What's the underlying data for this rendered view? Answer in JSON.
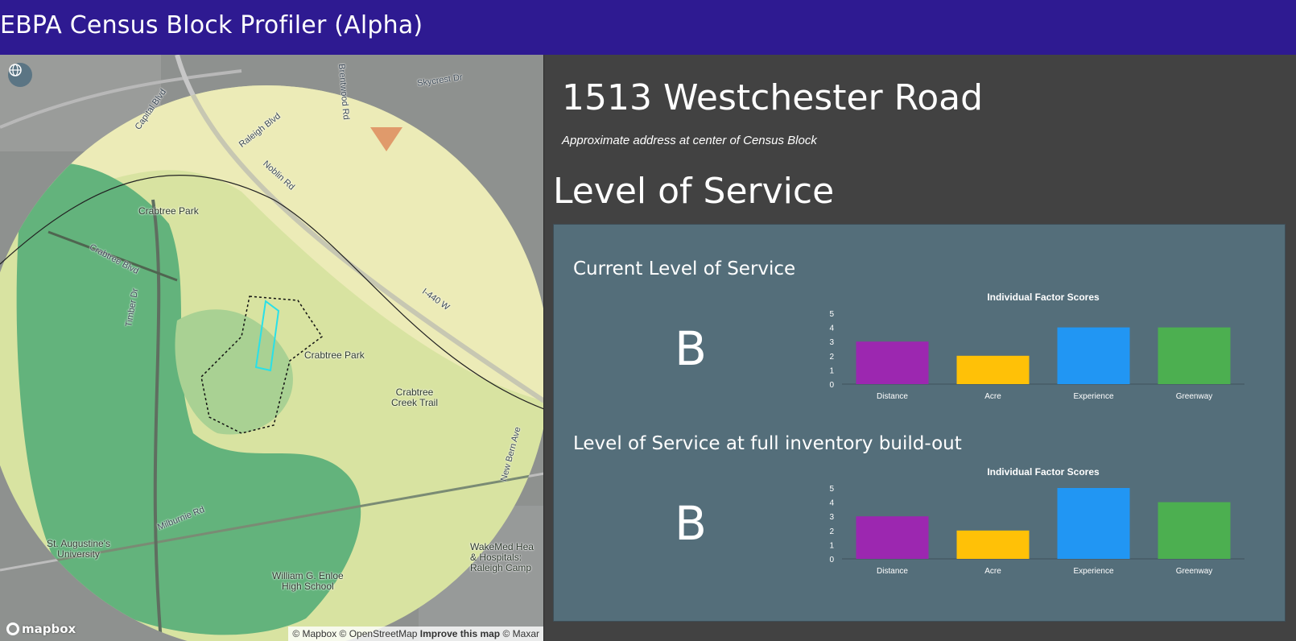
{
  "app": {
    "title": "EBPA Census Block Profiler (Alpha)"
  },
  "map": {
    "labels": {
      "crabtree_park_1": "Crabtree Park",
      "crabtree_park_2": "Crabtree Park",
      "crabtree_creek_trail": "Crabtree\nCreek Trail",
      "st_augustines": "St. Augustine's\nUniversity",
      "wakemed": "WakeMed Hea\n& Hospitals:\nRaleigh Camp",
      "enloe": "William G. Enloe\nHigh School"
    },
    "streets": {
      "skycrest": "Skycrest Dr",
      "brentwood": "Brentwood Rd",
      "capital": "Capital Blvd",
      "raleigh": "Raleigh Blvd",
      "noblin": "Noblin Rd",
      "crabtree_blvd": "Crabtree Blvd",
      "timber": "Timber Dr",
      "i440": "I-440 W",
      "new_bern": "New Bern Ave",
      "milburnie": "Milburnie Rd"
    },
    "logo_text": "mapbox",
    "attribution": {
      "mapbox": "© Mapbox",
      "osm": "© OpenStreetMap",
      "improve": "Improve this map",
      "maxar": "© Maxar"
    },
    "icons": {
      "globe": "globe-icon"
    }
  },
  "panel": {
    "address": "1513 Westchester Road",
    "address_note": "Approximate address at center of Census Block",
    "los_heading": "Level of Service",
    "current": {
      "title": "Current Level of Service",
      "grade": "B"
    },
    "buildout": {
      "title": "Level of Service at full inventory build-out",
      "grade": "B"
    }
  },
  "chart_data": [
    {
      "type": "bar",
      "title": "Individual Factor Scores",
      "categories": [
        "Distance",
        "Acre",
        "Experience",
        "Greenway"
      ],
      "values": [
        3,
        2,
        4,
        4
      ],
      "colors": [
        "#9c27b0",
        "#ffc107",
        "#2196f3",
        "#4caf50"
      ],
      "ylim": [
        0,
        5
      ],
      "yticks": [
        "0",
        "1",
        "2",
        "3",
        "4",
        "5"
      ]
    },
    {
      "type": "bar",
      "title": "Individual Factor Scores",
      "categories": [
        "Distance",
        "Acre",
        "Experience",
        "Greenway"
      ],
      "values": [
        3,
        2,
        5,
        4
      ],
      "colors": [
        "#9c27b0",
        "#ffc107",
        "#2196f3",
        "#4caf50"
      ],
      "ylim": [
        0,
        5
      ],
      "yticks": [
        "0",
        "1",
        "2",
        "3",
        "4",
        "5"
      ]
    }
  ]
}
